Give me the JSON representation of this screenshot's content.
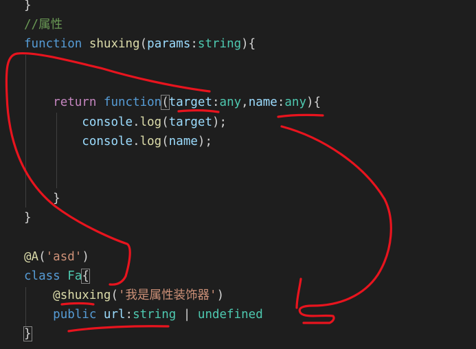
{
  "code": {
    "l0": {
      "brace": "}"
    },
    "l1": {
      "comment": "//属性"
    },
    "l2": {
      "kw": "function",
      "name": "shuxing",
      "open": "(",
      "param": "params",
      "colon": ":",
      "type": "string",
      "close": "){"
    },
    "l5": {
      "ret": "return",
      "kw": "function",
      "open": "(",
      "p1": "target",
      "c1": ":",
      "t1": "any",
      "comma": ",",
      "p2": "name",
      "c2": ":",
      "t2": "any",
      "close": "){"
    },
    "l6": {
      "obj": "console",
      "dot": ".",
      "method": "log",
      "open": "(",
      "arg": "target",
      "close": ");"
    },
    "l7": {
      "obj": "console",
      "dot": ".",
      "method": "log",
      "open": "(",
      "arg": "name",
      "close": ");"
    },
    "l10": {
      "brace": "}"
    },
    "l11": {
      "brace": "}"
    },
    "l13": {
      "at": "@A",
      "open": "(",
      "str": "'asd'",
      "close": ")"
    },
    "l14": {
      "kw": "class",
      "name": "Fa",
      "open": "{"
    },
    "l15": {
      "at": "@shuxing",
      "open": "(",
      "str": "'我是属性装饰器'",
      "close": ")"
    },
    "l16": {
      "mod": "public",
      "prop": "url",
      "colon": ":",
      "t1": "string",
      "pipe": " | ",
      "t2": "undefined"
    },
    "l17": {
      "brace": "}"
    }
  },
  "colors": {
    "background": "#1e1e1e",
    "annotation_ink": "#e8141e"
  }
}
